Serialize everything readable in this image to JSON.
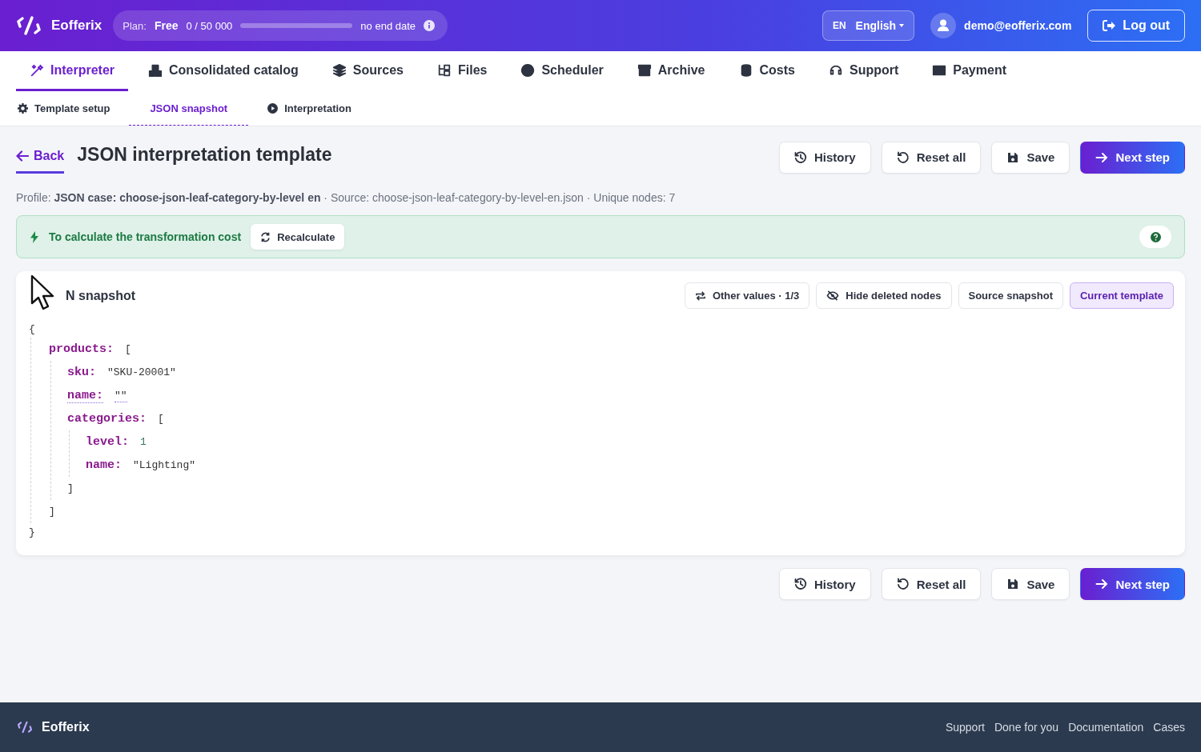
{
  "header": {
    "brand": "Eofferix",
    "plan": {
      "label": "Plan:",
      "name": "Free",
      "usage": "0 / 50 000",
      "level": 0,
      "expiry": "no end date"
    },
    "language": {
      "code": "EN",
      "name": "English"
    },
    "user": "demo@eofferix.com",
    "logout": "Log out"
  },
  "tabs": [
    {
      "label": "Interpreter",
      "selected": true
    },
    {
      "label": "Consolidated catalog",
      "selected": false
    },
    {
      "label": "Sources",
      "selected": false
    },
    {
      "label": "Files",
      "selected": false
    },
    {
      "label": "Scheduler",
      "selected": false
    },
    {
      "label": "Archive",
      "selected": false
    },
    {
      "label": "Costs",
      "selected": false
    },
    {
      "label": "Support",
      "selected": false
    },
    {
      "label": "Payment",
      "selected": false
    }
  ],
  "subtabs": [
    {
      "label": "Template setup",
      "selected": false
    },
    {
      "label": "JSON snapshot",
      "selected": true
    },
    {
      "label": "Interpretation",
      "selected": false
    }
  ],
  "page": {
    "back": "Back",
    "title": "JSON interpretation template",
    "actions": [
      "History",
      "Reset all",
      "Save",
      "Next step"
    ],
    "meta": {
      "profile_label": "Profile:",
      "profile": "JSON case: choose-json-leaf-category-by-level en",
      "rest": "· Source: choose-json-leaf-category-by-level-en.json · Unique nodes: 7"
    },
    "notice": {
      "text": "To calculate the transformation cost",
      "button": "Recalculate"
    }
  },
  "snapshot": {
    "title": "N snapshot",
    "views": [
      {
        "label": "Other values · 1/3",
        "kind": "cycle",
        "selected": false
      },
      {
        "label": "Hide deleted nodes",
        "kind": "hide",
        "selected": false
      },
      {
        "label": "Source snapshot",
        "kind": "plain",
        "selected": false
      },
      {
        "label": "Current template",
        "kind": "plain",
        "selected": true
      }
    ],
    "tree": {
      "open": "{",
      "close": "}",
      "children": [
        {
          "key": "products:",
          "open": "[",
          "close": "]",
          "children": [
            {
              "key": "sku:",
              "value": "\"SKU-20001\"",
              "kind": "string"
            },
            {
              "key": "name:",
              "value": "\"\"",
              "kind": "empty"
            },
            {
              "key": "categories:",
              "open": "[",
              "close": "]",
              "children": [
                {
                  "key": "level:",
                  "value": "1",
                  "kind": "number"
                },
                {
                  "key": "name:",
                  "value": "\"Lighting\"",
                  "kind": "string"
                }
              ]
            }
          ]
        }
      ]
    }
  },
  "bottom_actions": [
    "History",
    "Reset all",
    "Save",
    "Next step"
  ],
  "footer": {
    "brand": "Eofferix",
    "links": [
      "Support",
      "Done for you",
      "Documentation",
      "Cases"
    ]
  }
}
